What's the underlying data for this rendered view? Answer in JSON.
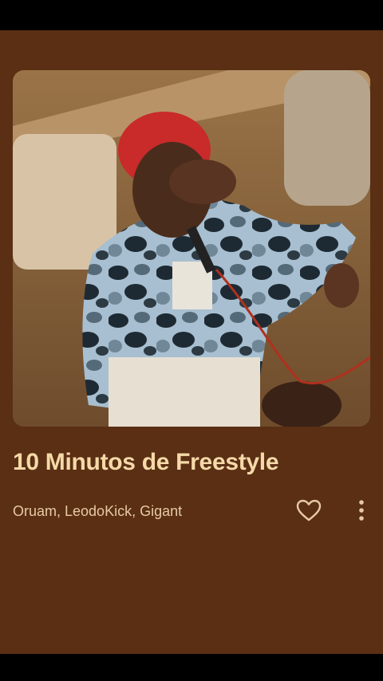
{
  "track": {
    "title": "10 Minutos de Freestyle",
    "artists": "Oruam, LeodoKick, Gigant"
  },
  "actions": {
    "like_icon": "heart-outline-icon",
    "more_icon": "more-vertical-icon"
  },
  "colors": {
    "background": "#5a2f14",
    "title": "#f5d9a8",
    "artists": "#e8c9a4",
    "icons": "#e8c9a4"
  }
}
